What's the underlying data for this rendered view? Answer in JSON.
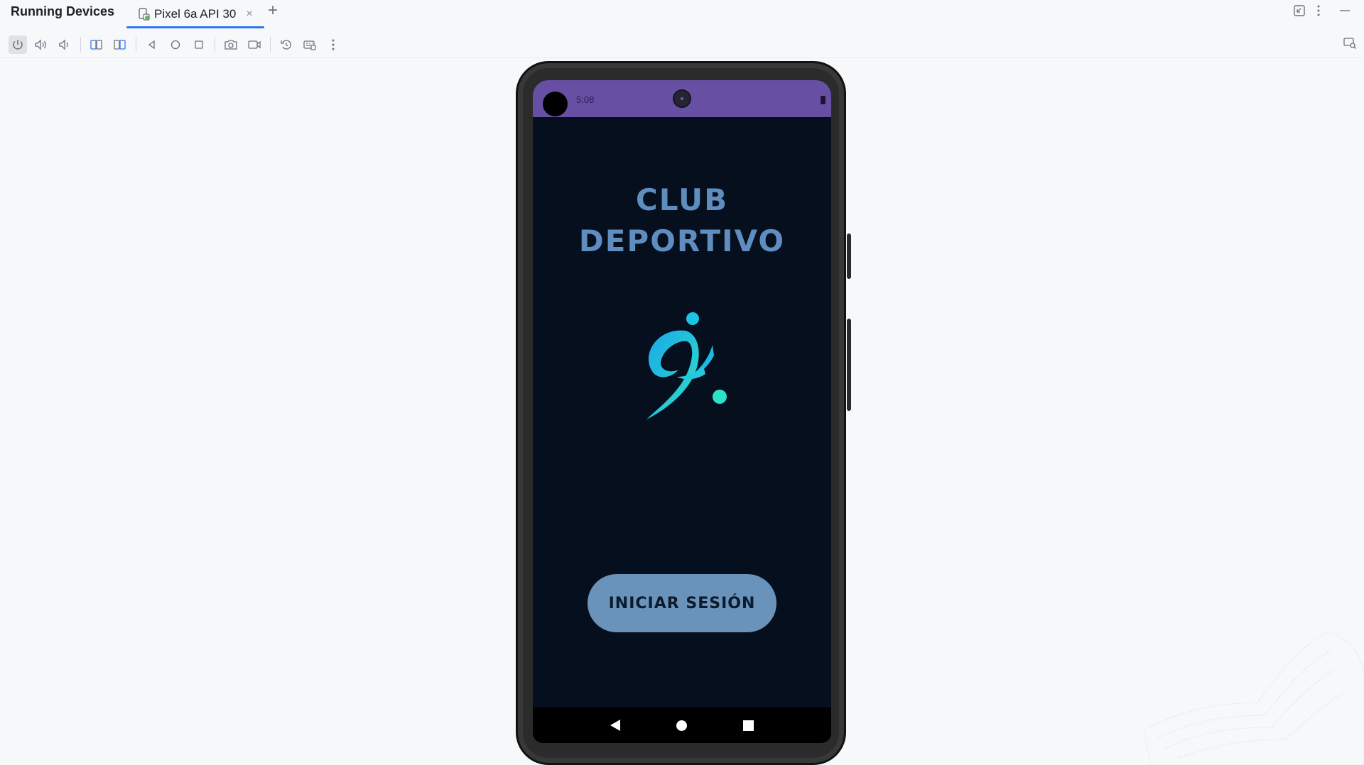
{
  "titlebar": {
    "panel_title": "Running Devices",
    "tab_label": "Pixel 6a API 30",
    "tab_close": "×",
    "add_tab": "+"
  },
  "toolbar": {
    "buttons": [
      {
        "name": "power-icon",
        "active": true
      },
      {
        "name": "volume-up-icon"
      },
      {
        "name": "volume-down-icon"
      },
      {
        "name": "rotate-left-icon"
      },
      {
        "name": "rotate-right-icon"
      },
      {
        "name": "back-icon"
      },
      {
        "name": "home-icon"
      },
      {
        "name": "overview-icon"
      },
      {
        "name": "screenshot-icon"
      },
      {
        "name": "screen-record-icon"
      },
      {
        "name": "reset-icon"
      },
      {
        "name": "keyboard-icon"
      },
      {
        "name": "more-icon"
      }
    ]
  },
  "device": {
    "status_time": "5:08",
    "app_title_line1": "CLUB",
    "app_title_line2": "DEPORTIVO",
    "login_button": "INICIAR SESIÓN",
    "colors": {
      "statusbar": "#6750a4",
      "screen_bg": "#050f1e",
      "title": "#5f8dbf",
      "button_bg": "#6a93bb",
      "logo_cyan": "#19c9e0",
      "logo_teal": "#2fe0c8"
    }
  }
}
